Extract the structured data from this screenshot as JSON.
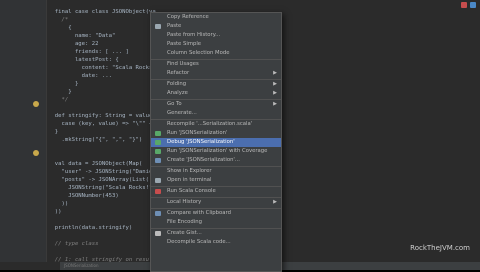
{
  "colors": {
    "editor_bg": "#2b2b2b",
    "gutter_bg": "#313335",
    "menu_bg": "#3c3f41",
    "menu_selected": "#4b6eaf",
    "keyword": "#cc7832",
    "string": "#6a8759"
  },
  "code": [
    "  final case class JSONObject(va",
    "    /*",
    "      {",
    "        name: \"Data\"",
    "        age: 22",
    "        friends: [ ... ]",
    "        latestPost: {",
    "          content: \"Scala Rocks\"",
    "          date: ...",
    "        }",
    "      }",
    "    */",
    "",
    "  def stringify: String = value",
    "    case (key, value) => \"\\\"\" +",
    "  }",
    "    .mkString(\"{\", \",\", \"}\")",
    "",
    "",
    "  val data = JSONObject(Map(",
    "    \"user\" -> JSONString(\"Daniel",
    "    \"posts\" -> JSONArray(List(",
    "      JSONString(\"Scala Rocks!\"),",
    "      JSONNumber(453)",
    "    ))",
    "  ))",
    "",
    "  println(data.stringify)",
    "",
    "  // type class",
    "",
    "  // 1: call stringify on result"
  ],
  "menu": [
    {
      "label": "Copy Reference",
      "shortcut": "",
      "icon": "",
      "arrow": false,
      "sep_after": false
    },
    {
      "label": "Paste",
      "icon": "paste-icon",
      "arrow": false,
      "sep_after": false
    },
    {
      "label": "Paste from History...",
      "icon": "",
      "arrow": false,
      "sep_after": false
    },
    {
      "label": "Paste Simple",
      "icon": "",
      "arrow": false,
      "sep_after": false
    },
    {
      "label": "Column Selection Mode",
      "icon": "",
      "arrow": false,
      "sep_after": true
    },
    {
      "label": "Find Usages",
      "icon": "",
      "arrow": false,
      "sep_after": false
    },
    {
      "label": "Refactor",
      "icon": "",
      "arrow": true,
      "sep_after": true
    },
    {
      "label": "Folding",
      "icon": "",
      "arrow": true,
      "sep_after": false
    },
    {
      "label": "Analyze",
      "icon": "",
      "arrow": true,
      "sep_after": true
    },
    {
      "label": "Go To",
      "icon": "",
      "arrow": true,
      "sep_after": false
    },
    {
      "label": "Generate...",
      "icon": "",
      "arrow": false,
      "sep_after": true
    },
    {
      "label": "Recompile '...Serialization.scala'",
      "icon": "",
      "arrow": false,
      "sep_after": false
    },
    {
      "label": "Run 'JSONSerialization'",
      "icon": "run-icon",
      "arrow": false,
      "sep_after": false
    },
    {
      "label": "Debug 'JSONSerialization'",
      "icon": "debug-icon",
      "arrow": false,
      "sep_after": false,
      "selected": true
    },
    {
      "label": "Run 'JSONSerialization' with Coverage",
      "icon": "coverage-icon",
      "arrow": false,
      "sep_after": false
    },
    {
      "label": "Create 'JSONSerialization'...",
      "icon": "create-config-icon",
      "arrow": false,
      "sep_after": true
    },
    {
      "label": "Show in Explorer",
      "icon": "",
      "arrow": false,
      "sep_after": false
    },
    {
      "label": "Open in terminal",
      "icon": "terminal-icon",
      "arrow": false,
      "sep_after": true
    },
    {
      "label": "Run Scala Console",
      "icon": "scala-console-icon",
      "arrow": false,
      "sep_after": true
    },
    {
      "label": "Local History",
      "icon": "",
      "arrow": true,
      "sep_after": true
    },
    {
      "label": "Compare with Clipboard",
      "icon": "compare-icon",
      "arrow": false,
      "sep_after": false
    },
    {
      "label": "File Encoding",
      "icon": "",
      "arrow": false,
      "sep_after": true
    },
    {
      "label": "Create Gist...",
      "icon": "gist-icon",
      "arrow": false,
      "sep_after": false
    },
    {
      "label": "Decompile Scala code...",
      "icon": "",
      "arrow": false,
      "sep_after": false
    }
  ],
  "watermark": "RockTheJVM.com",
  "bottom_tab": "JSONSerialization"
}
